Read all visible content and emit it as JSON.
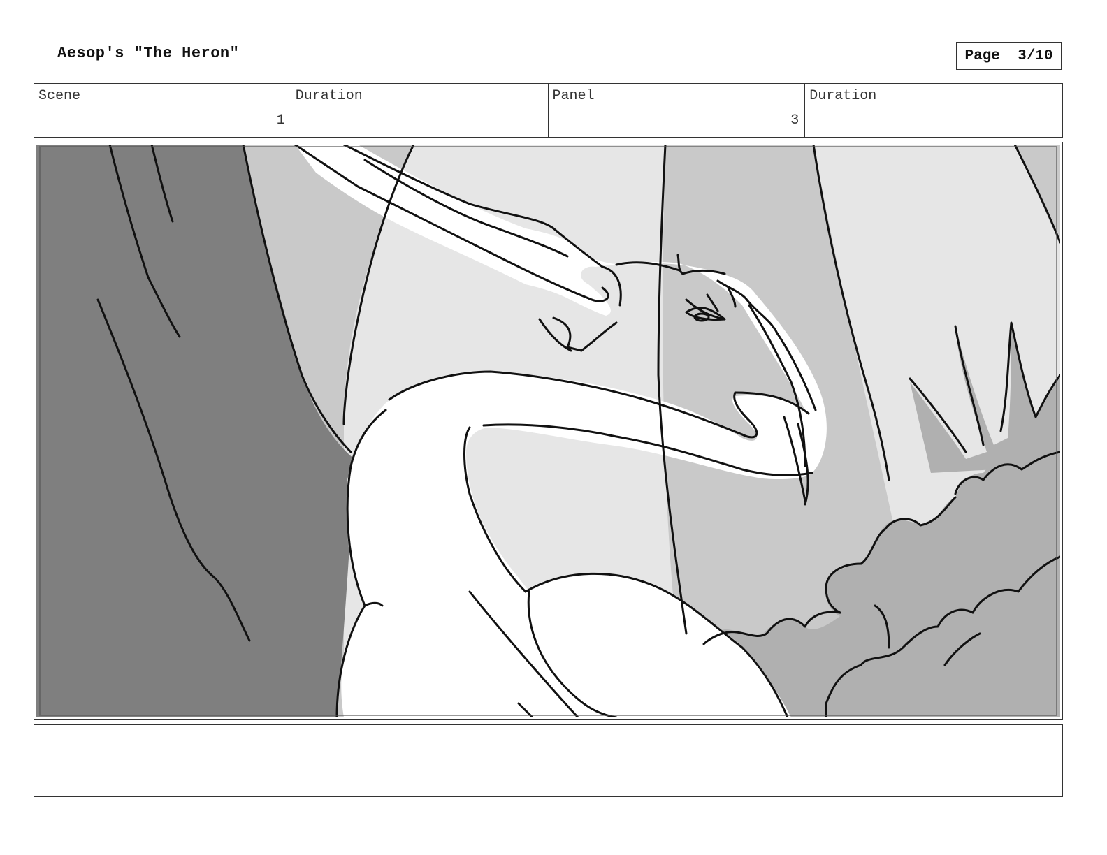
{
  "header": {
    "title": "Aesop's \"The Heron\"",
    "page_label": "Page  3/10"
  },
  "info": {
    "scene_label": "Scene",
    "scene_value": "1",
    "scene_duration_label": "Duration",
    "scene_duration_value": "",
    "panel_label": "Panel",
    "panel_value": "3",
    "panel_duration_label": "Duration",
    "panel_duration_value": ""
  },
  "panel": {
    "image_subject": "heron-sketch",
    "colors": {
      "dark_tree": "#7f7f7f",
      "mid_tree": "#c9c9c9",
      "light_bg": "#e6e6e6",
      "bush": "#b0b0b0",
      "heron": "#ffffff",
      "line": "#111111"
    }
  },
  "notes": {
    "text": ""
  }
}
